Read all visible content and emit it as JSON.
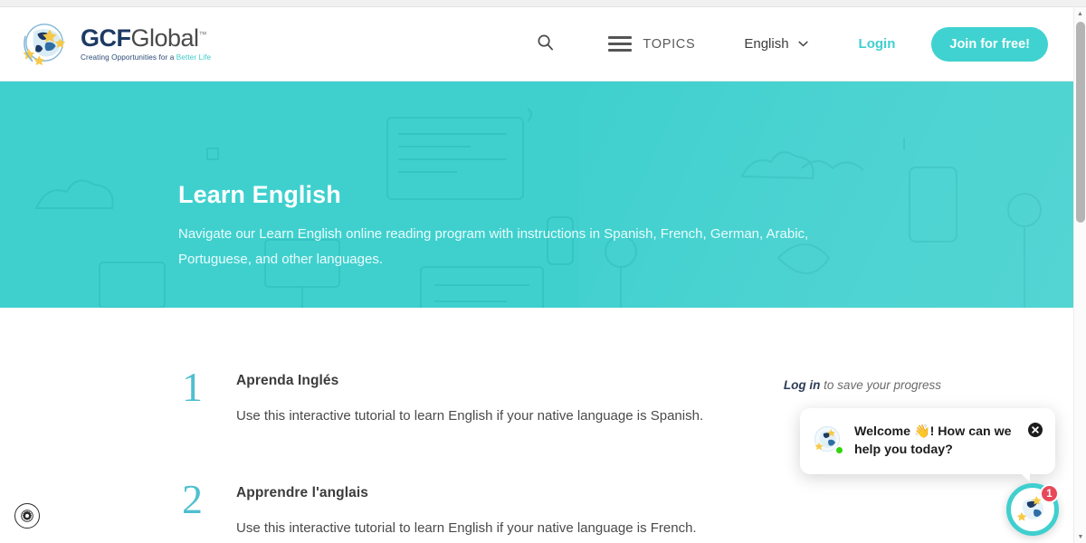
{
  "header": {
    "logo": {
      "icon": "gcf-globe-logo-icon",
      "word_primary": "GCF",
      "word_secondary": "Global",
      "trademark": "™",
      "tagline_primary": "Creating Opportunities for a ",
      "tagline_secondary": "Better Life"
    },
    "search_icon": "search-icon",
    "menu_icon": "hamburger-menu-icon",
    "topics_label": "TOPICS",
    "language_label": "English",
    "language_chevron": "chevron-down-icon",
    "login_label": "Login",
    "join_label": "Join for free!"
  },
  "hero": {
    "title": "Learn English",
    "subtitle": "Navigate our Learn English online reading program with instructions in Spanish, French, German, Arabic, Portuguese, and other languages.",
    "background_color": "#3fd0ce"
  },
  "main": {
    "login_note_strong": "Log in",
    "login_note_rest": " to save your progress",
    "items": [
      {
        "number": "1",
        "title": "Aprenda Inglés",
        "description": "Use this interactive tutorial to learn English if your native language is Spanish."
      },
      {
        "number": "2",
        "title": "Apprendre l'anglais",
        "description": "Use this interactive tutorial to learn English if your native language is French."
      }
    ]
  },
  "accessibility": {
    "icon": "gear-accessibility-icon"
  },
  "chat": {
    "avatar_icon": "gcf-globe-avatar-icon",
    "online_status": "online",
    "message": "Welcome 👋! How can we help you today?",
    "close_icon": "close-icon",
    "launcher_icon": "gcf-globe-launcher-icon",
    "unread_count": "1",
    "accent_color": "#3fcfce",
    "badge_color": "#e8485a"
  },
  "scrollbar": {
    "up_arrow": "▲",
    "down_arrow": "▼"
  }
}
